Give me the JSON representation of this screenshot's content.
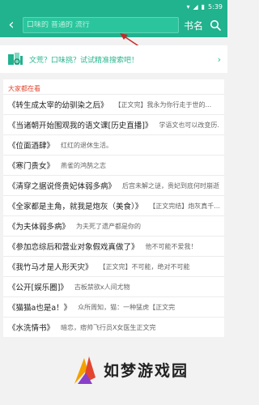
{
  "status": {
    "time": "5:39"
  },
  "header": {
    "back_icon": "chevron-left-icon",
    "search_placeholder": "口味的 普通的 流行",
    "book_button": "书名",
    "search_icon": "search-icon"
  },
  "tip": {
    "text": "文荒？口味挑？试试精准搜索吧！",
    "chevron": "›"
  },
  "section": {
    "title": "大家都在看"
  },
  "books": [
    {
      "title": "《转生成太宰的幼驯染之后》",
      "desc": "【正文完】我永为你行走于世的..."
    },
    {
      "title": "《当诸朝开始围观我的语文课[历史直播]》",
      "desc": "学语文也可以改变历..."
    },
    {
      "title": "《位面酒肆》",
      "desc": "红红的退休生活。"
    },
    {
      "title": "《寒门贵女》",
      "desc": "燕雀的鸿鹄之志"
    },
    {
      "title": "《清穿之据说佟贵妃体弱多病》",
      "desc": "后宫未解之谜，贵妃到底何时崩逝..."
    },
    {
      "title": "《全家都是主角，就我是炮灰（美食）》",
      "desc": "【正文完结】炮灰真千..."
    },
    {
      "title": "《为夫体弱多病》",
      "desc": "为夫死了遗产都是你的"
    },
    {
      "title": "《参加恋综后和营业对象假戏真做了》",
      "desc": "他不可能不爱我！"
    },
    {
      "title": "《我竹马才是人形天灾》",
      "desc": "【正文完】不可能，绝对不可能"
    },
    {
      "title": "《公开[娱乐圈]》",
      "desc": "古板禁欲x人间尤物"
    },
    {
      "title": "《猫猫a也是a！》",
      "desc": "众所周知，猫：一种猛虎【正文完"
    },
    {
      "title": "《水洗情书》",
      "desc": "暗恋，痞帅飞行员X女医生正文完"
    }
  ],
  "watermark": {
    "text": "如梦游戏园"
  },
  "colors": {
    "accent": "#21b28e",
    "highlight": "#e3452e"
  }
}
